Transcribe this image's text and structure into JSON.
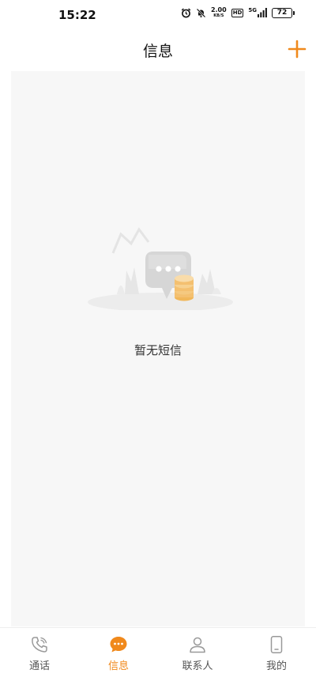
{
  "status_bar": {
    "time": "15:22",
    "network_speed_value": "2.00",
    "network_speed_unit": "KB/S",
    "hd_label": "HD",
    "signal_label": "5G",
    "battery_level": "72",
    "icons": [
      "alarm-icon",
      "mute-icon",
      "hd-icon",
      "signal-icon",
      "battery-icon"
    ]
  },
  "header": {
    "title": "信息",
    "add_icon": "plus-icon"
  },
  "main": {
    "empty_text": "暂无短信",
    "illustration": "empty-message-illustration"
  },
  "tab_bar": {
    "tabs": [
      {
        "label": "通话",
        "icon": "phone-icon",
        "active": false
      },
      {
        "label": "信息",
        "icon": "message-icon",
        "active": true
      },
      {
        "label": "联系人",
        "icon": "person-icon",
        "active": false
      },
      {
        "label": "我的",
        "icon": "mobile-icon",
        "active": false
      }
    ]
  },
  "colors": {
    "accent": "#f0891c",
    "content_background": "#f7f7f7",
    "inactive_icon": "#999999"
  }
}
